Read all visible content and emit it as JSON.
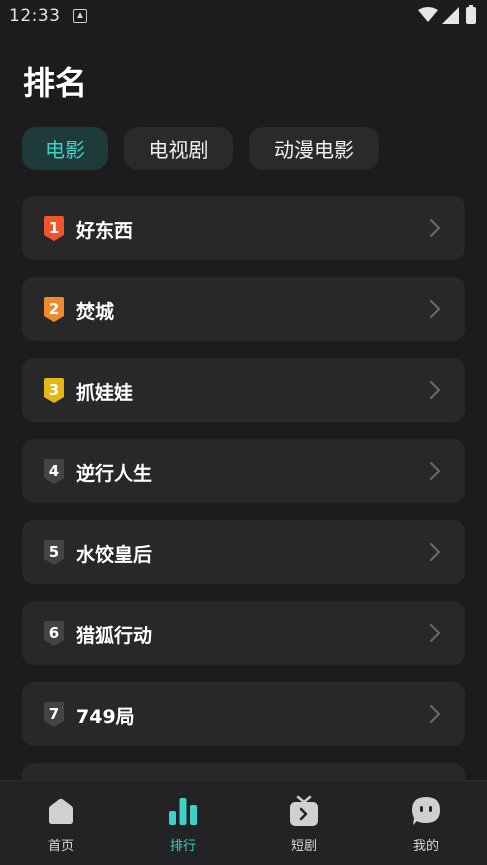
{
  "status_bar": {
    "time": "12:33"
  },
  "page": {
    "title": "排名"
  },
  "tabs": [
    {
      "label": "电影",
      "active": true
    },
    {
      "label": "电视剧",
      "active": false
    },
    {
      "label": "动漫电影",
      "active": false
    }
  ],
  "ranking": [
    {
      "rank": "1",
      "title": "好东西",
      "badge_color": "#f0542b"
    },
    {
      "rank": "2",
      "title": "焚城",
      "badge_color": "#f08b2b"
    },
    {
      "rank": "3",
      "title": "抓娃娃",
      "badge_color": "#e6b714"
    },
    {
      "rank": "4",
      "title": "逆行人生",
      "badge_color": "#444446"
    },
    {
      "rank": "5",
      "title": "水饺皇后",
      "badge_color": "#444446"
    },
    {
      "rank": "6",
      "title": "猎狐行动",
      "badge_color": "#444446"
    },
    {
      "rank": "7",
      "title": "749局",
      "badge_color": "#444446"
    }
  ],
  "bottom_nav": [
    {
      "label": "首页",
      "icon": "home-icon",
      "active": false
    },
    {
      "label": "排行",
      "icon": "ranking-bars-icon",
      "active": true
    },
    {
      "label": "短剧",
      "icon": "tv-play-icon",
      "active": false
    },
    {
      "label": "我的",
      "icon": "profile-face-icon",
      "active": false
    }
  ],
  "colors": {
    "accent": "#3ed1c7",
    "background": "#1c1c1e",
    "card": "#28282a"
  }
}
